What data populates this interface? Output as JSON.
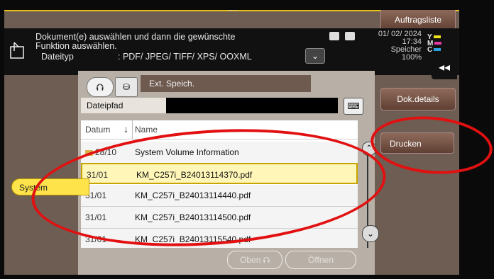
{
  "header": {
    "line1": "Dokument(e) auswählen und dann die gewünschte",
    "line2": "Funktion auswählen.",
    "type_label": "Dateityp",
    "type_value": ": PDF/ JPEG/ TIFF/ XPS/ OOXML",
    "date": "01/ 02/ 2024",
    "time": "17:34",
    "memory_label": "Speicher",
    "memory_value": "100%",
    "toner": [
      {
        "letter": "Y",
        "color": "#f2e21a"
      },
      {
        "letter": "M",
        "color": "#e23aa6"
      },
      {
        "letter": "C",
        "color": "#2aa2e0"
      }
    ]
  },
  "buttons": {
    "job_list": "Auftragsliste",
    "doc_details": "Dok.details",
    "print": "Drucken",
    "top": "Oben",
    "open": "Öffnen",
    "collapse": "◂◂"
  },
  "panel": {
    "storage_label": "Ext. Speich.",
    "path_label": "Dateipfad",
    "path_value": ""
  },
  "list": {
    "col_date": "Datum",
    "col_name": "Name",
    "rows": [
      {
        "date": "28/10",
        "name": "System Volume Information",
        "folder": true
      },
      {
        "date": "31/01",
        "name": "KM_C257i_B24013114370.pdf",
        "selected": true
      },
      {
        "date": "31/01",
        "name": "KM_C257i_B24013114440.pdf"
      },
      {
        "date": "31/01",
        "name": "KM_C257i_B24013114500.pdf"
      },
      {
        "date": "31/01",
        "name": "KM_C257i_B24013115540.pdf"
      }
    ]
  },
  "side_tab": {
    "label": "System"
  }
}
